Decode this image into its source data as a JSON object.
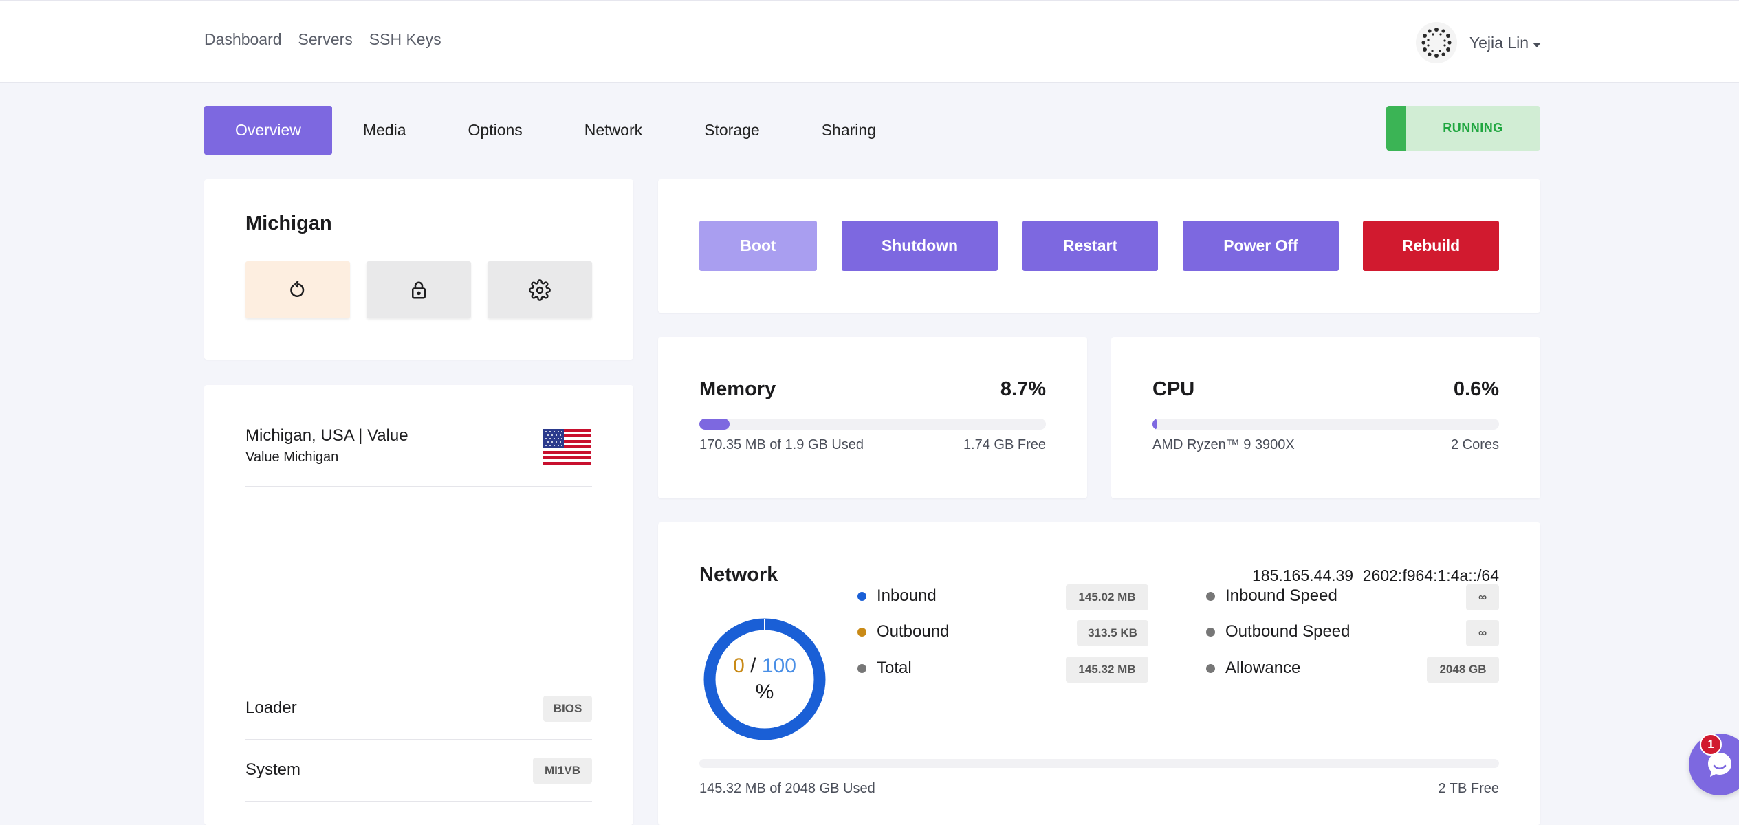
{
  "nav": {
    "links": [
      "Dashboard",
      "Servers",
      "SSH Keys"
    ],
    "user_name": "Yejia Lin"
  },
  "tabs": [
    "Overview",
    "Media",
    "Options",
    "Network",
    "Storage",
    "Sharing"
  ],
  "active_tab": "Overview",
  "status": "RUNNING",
  "server": {
    "name": "Michigan",
    "quick_actions": [
      "refresh-icon",
      "lock-icon",
      "gear-icon"
    ]
  },
  "info": {
    "location": "Michigan, USA | Value",
    "plan": "Value Michigan",
    "flag": "us-flag-icon",
    "rows": [
      {
        "label": "Loader",
        "value": "BIOS"
      },
      {
        "label": "System",
        "value": "MI1VB"
      }
    ]
  },
  "actions": {
    "boot": "Boot",
    "shutdown": "Shutdown",
    "restart": "Restart",
    "power_off": "Power Off",
    "rebuild": "Rebuild"
  },
  "memory": {
    "title": "Memory",
    "percent": "8.7%",
    "fill_fraction": 0.087,
    "used": "170.35 MB of 1.9 GB Used",
    "free": "1.74 GB Free"
  },
  "cpu": {
    "title": "CPU",
    "percent": "0.6%",
    "fill_fraction": 0.006,
    "model": "AMD Ryzen™ 9 3900X",
    "cores": "2 Cores"
  },
  "network": {
    "title": "Network",
    "ipv4": "185.165.44.39",
    "ipv6": "2602:f964:1:4a::/64",
    "donut": {
      "used": "0",
      "sep": "/",
      "total": "100",
      "unit": "%",
      "fraction": 0.0
    },
    "stats_left": [
      {
        "label": "Inbound",
        "value": "145.02 MB",
        "color": "#1a5fd6"
      },
      {
        "label": "Outbound",
        "value": "313.5 KB",
        "color": "#c98a17"
      },
      {
        "label": "Total",
        "value": "145.32 MB",
        "color": "#777777"
      }
    ],
    "stats_right": [
      {
        "label": "Inbound Speed",
        "value": "∞",
        "color": "#777777"
      },
      {
        "label": "Outbound Speed",
        "value": "∞",
        "color": "#777777"
      },
      {
        "label": "Allowance",
        "value": "2048 GB",
        "color": "#777777"
      }
    ],
    "used": "145.32 MB of 2048 GB Used",
    "free": "2 TB Free",
    "fill_fraction": 0.0001
  },
  "chat": {
    "notifications": "1"
  },
  "colors": {
    "accent": "#7d68e0",
    "danger": "#d11a2f",
    "running_bg": "#d1edd4",
    "running_text": "#1fa63f"
  }
}
